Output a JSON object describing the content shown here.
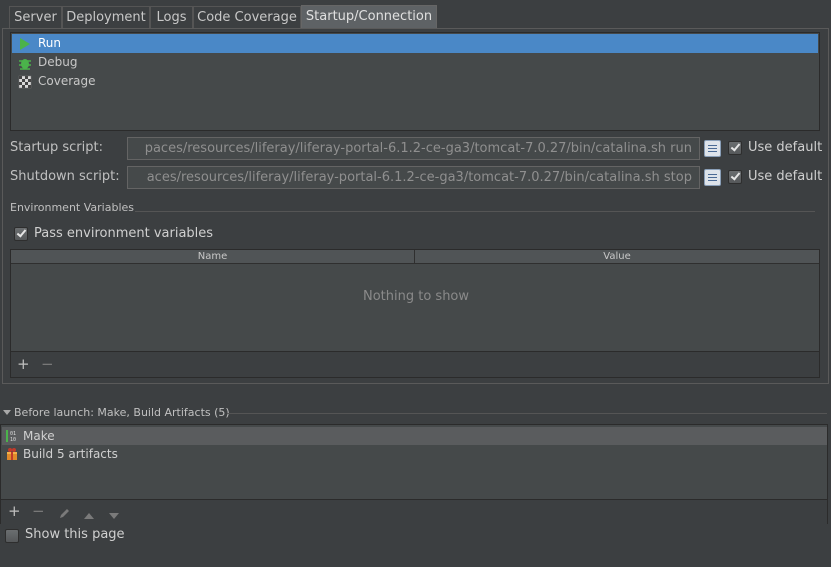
{
  "tabs": [
    {
      "label": "Server",
      "selected": false
    },
    {
      "label": "Deployment",
      "selected": false
    },
    {
      "label": "Logs",
      "selected": false
    },
    {
      "label": "Code Coverage",
      "selected": false
    },
    {
      "label": "Startup/Connection",
      "selected": true
    }
  ],
  "executors": [
    {
      "label": "Run",
      "icon": "run-icon",
      "selected": true
    },
    {
      "label": "Debug",
      "icon": "debug-icon",
      "selected": false
    },
    {
      "label": "Coverage",
      "icon": "coverage-icon",
      "selected": false
    }
  ],
  "startup": {
    "label": "Startup script:",
    "value": "paces/resources/liferay/liferay-portal-6.1.2-ce-ga3/tomcat-7.0.27/bin/catalina.sh run",
    "use_default_label": "Use default",
    "use_default_checked": true
  },
  "shutdown": {
    "label": "Shutdown script:",
    "value": "aces/resources/liferay/liferay-portal-6.1.2-ce-ga3/tomcat-7.0.27/bin/catalina.sh stop",
    "use_default_label": "Use default",
    "use_default_checked": true
  },
  "env": {
    "section_title": "Environment Variables",
    "pass_label": "Pass environment variables",
    "pass_checked": true,
    "columns": [
      "Name",
      "Value"
    ],
    "empty_text": "Nothing to show",
    "add_symbol": "+",
    "remove_symbol": "−"
  },
  "before_launch": {
    "title": "Before launch: Make, Build Artifacts (5)",
    "items": [
      {
        "label": "Make",
        "icon": "make-icon",
        "selected": true
      },
      {
        "label": "Build 5 artifacts",
        "icon": "artifacts-icon",
        "selected": false
      }
    ],
    "add_symbol": "+",
    "remove_symbol": "−"
  },
  "show_page": {
    "label": "Show this page",
    "checked": false
  },
  "colors": {
    "background": "#3c3f41",
    "selection": "#4a88c7",
    "run_green": "#4bb34b"
  }
}
